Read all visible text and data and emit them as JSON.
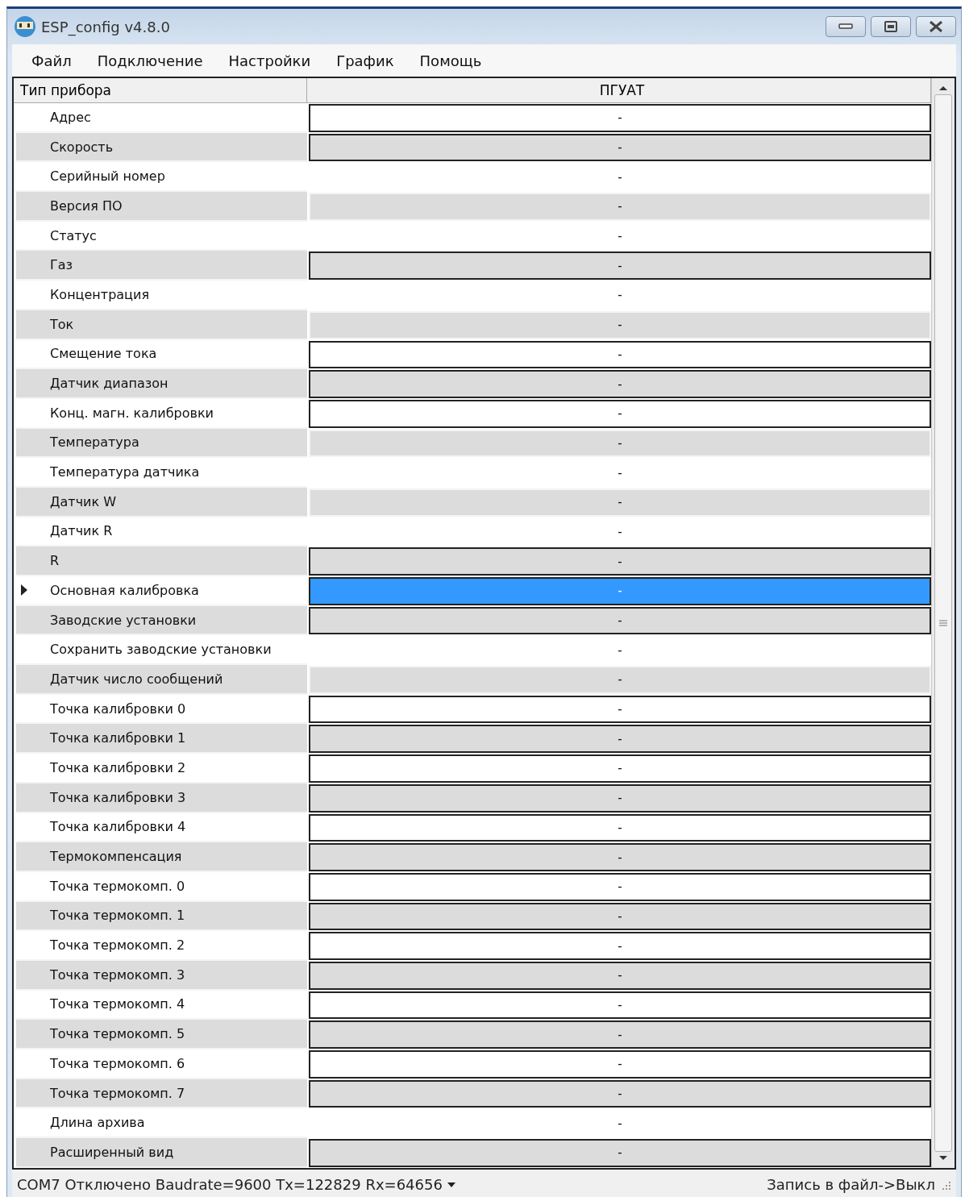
{
  "window": {
    "title": "ESP_config v4.8.0"
  },
  "menu": [
    "Файл",
    "Подключение",
    "Настройки",
    "График",
    "Помощь"
  ],
  "grid": {
    "columns": [
      "Тип прибора",
      "ПГУАТ"
    ],
    "rows": [
      {
        "label": "Адрес",
        "value": "-",
        "editable": true,
        "selected": false
      },
      {
        "label": "Скорость",
        "value": "-",
        "editable": true,
        "selected": false
      },
      {
        "label": "Серийный номер",
        "value": "-",
        "editable": false,
        "selected": false
      },
      {
        "label": "Версия ПО",
        "value": "-",
        "editable": false,
        "selected": false
      },
      {
        "label": "Статус",
        "value": "-",
        "editable": false,
        "selected": false
      },
      {
        "label": "Газ",
        "value": "-",
        "editable": true,
        "selected": false
      },
      {
        "label": "Концентрация",
        "value": "-",
        "editable": false,
        "selected": false
      },
      {
        "label": "Ток",
        "value": "-",
        "editable": false,
        "selected": false
      },
      {
        "label": "Смещение тока",
        "value": "-",
        "editable": true,
        "selected": false
      },
      {
        "label": "Датчик диапазон",
        "value": "-",
        "editable": true,
        "selected": false
      },
      {
        "label": "Конц. магн. калибровки",
        "value": "-",
        "editable": true,
        "selected": false
      },
      {
        "label": "Температура",
        "value": "-",
        "editable": false,
        "selected": false
      },
      {
        "label": "Температура датчика",
        "value": "-",
        "editable": false,
        "selected": false
      },
      {
        "label": "Датчик W",
        "value": "-",
        "editable": false,
        "selected": false
      },
      {
        "label": "Датчик R",
        "value": "-",
        "editable": false,
        "selected": false
      },
      {
        "label": "R",
        "value": "-",
        "editable": true,
        "selected": false
      },
      {
        "label": "Основная калибровка",
        "value": "-",
        "editable": true,
        "selected": true
      },
      {
        "label": "Заводские установки",
        "value": "-",
        "editable": true,
        "selected": false
      },
      {
        "label": "Сохранить заводские установки",
        "value": "-",
        "editable": false,
        "selected": false
      },
      {
        "label": "Датчик число сообщений",
        "value": "-",
        "editable": false,
        "selected": false
      },
      {
        "label": "Точка калибровки 0",
        "value": "-",
        "editable": true,
        "selected": false
      },
      {
        "label": "Точка калибровки 1",
        "value": "-",
        "editable": true,
        "selected": false
      },
      {
        "label": "Точка калибровки 2",
        "value": "-",
        "editable": true,
        "selected": false
      },
      {
        "label": "Точка калибровки 3",
        "value": "-",
        "editable": true,
        "selected": false
      },
      {
        "label": "Точка калибровки 4",
        "value": "-",
        "editable": true,
        "selected": false
      },
      {
        "label": "Термокомпенсация",
        "value": "-",
        "editable": true,
        "selected": false
      },
      {
        "label": "Точка термокомп. 0",
        "value": "-",
        "editable": true,
        "selected": false
      },
      {
        "label": "Точка термокомп. 1",
        "value": "-",
        "editable": true,
        "selected": false
      },
      {
        "label": "Точка термокомп. 2",
        "value": "-",
        "editable": true,
        "selected": false
      },
      {
        "label": "Точка термокомп. 3",
        "value": "-",
        "editable": true,
        "selected": false
      },
      {
        "label": "Точка термокомп. 4",
        "value": "-",
        "editable": true,
        "selected": false
      },
      {
        "label": "Точка термокомп. 5",
        "value": "-",
        "editable": true,
        "selected": false
      },
      {
        "label": "Точка термокомп. 6",
        "value": "-",
        "editable": true,
        "selected": false
      },
      {
        "label": "Точка термокомп. 7",
        "value": "-",
        "editable": true,
        "selected": false
      },
      {
        "label": "Длина архива",
        "value": "-",
        "editable": false,
        "selected": false
      },
      {
        "label": "Расширенный вид",
        "value": "-",
        "editable": true,
        "selected": false
      }
    ]
  },
  "status_bar": {
    "connection": "COM7 Отключено Baudrate=9600 Tx=122829 Rx=64656",
    "recording": "Запись в файл->Выкл"
  }
}
